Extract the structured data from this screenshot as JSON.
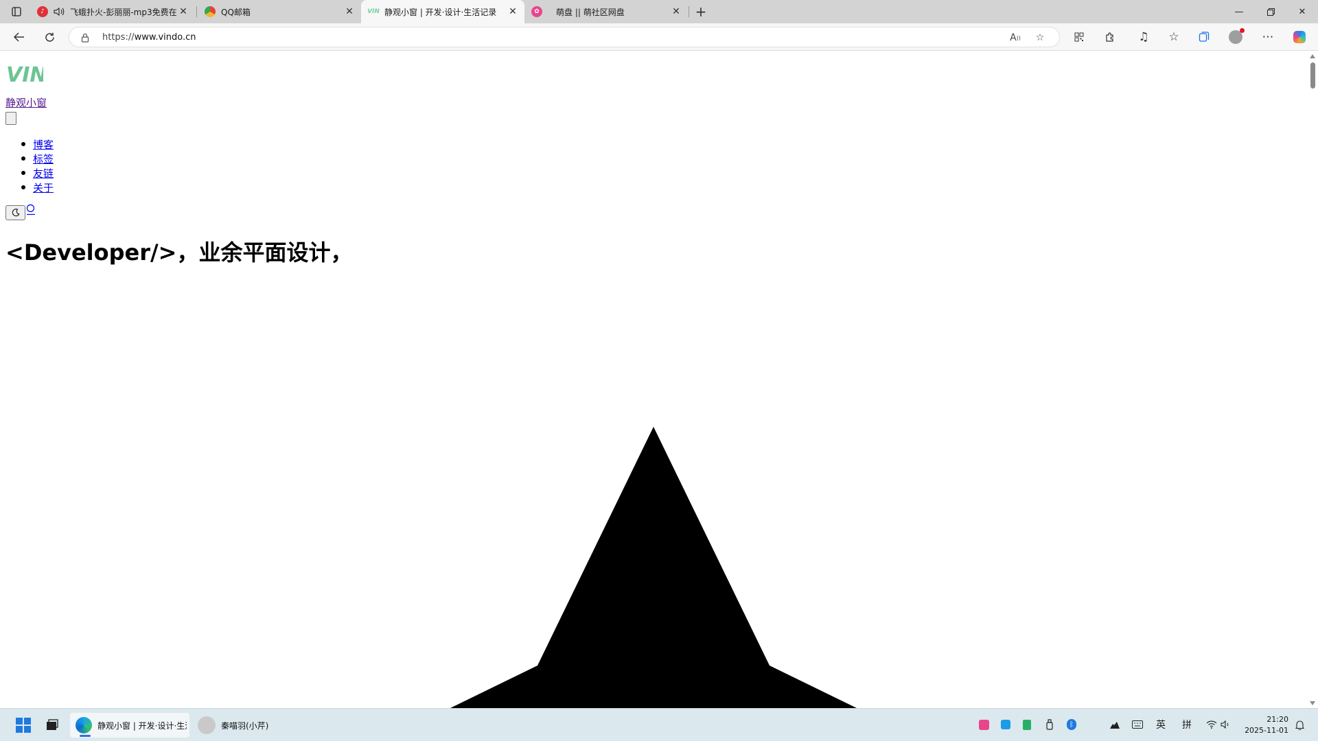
{
  "browser": {
    "tabs": [
      {
        "title": "飞蛾扑火-彭丽丽-mp3免费在",
        "favicon": "music-favicon",
        "favicon_color": "#e0303a",
        "audio": true,
        "active": false
      },
      {
        "title": "QQ邮箱",
        "favicon": "qq-mail-favicon",
        "favicon_color": "#f2b72a",
        "audio": false,
        "active": false
      },
      {
        "title": "静观小窗 | 开发·设计·生活记录",
        "favicon": "vin-favicon",
        "favicon_color": "#7ccf9f",
        "audio": false,
        "active": true
      },
      {
        "title": "萌盘 || 萌社区网盘",
        "favicon": "mengpan-favicon",
        "favicon_color": "#e8458b",
        "audio": false,
        "active": false
      }
    ],
    "address": {
      "scheme": "https://",
      "host": "www.vindo.cn"
    }
  },
  "page": {
    "logo_text": "VIN",
    "logo_color": "#6cc593",
    "site_title": "静观小窗",
    "nav_items": [
      "博客",
      "标签",
      "友链",
      "关于"
    ],
    "hero_text": "<Developer/>，业余平面设计，"
  },
  "taskbar": {
    "apps": [
      {
        "label": "静观小窗 | 开发·设计·生活",
        "icon": "edge-icon",
        "active": true
      },
      {
        "label": "秦喵羽(小芹)",
        "icon": "user-avatar-icon",
        "active": false
      }
    ],
    "ime_lang": "英",
    "ime_mode": "拼",
    "time": "21:20",
    "date": "2025-11-01"
  }
}
